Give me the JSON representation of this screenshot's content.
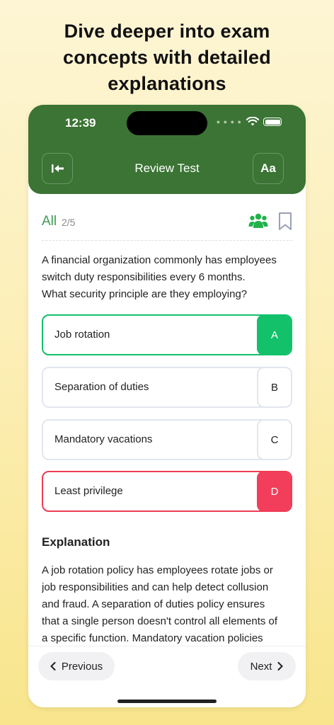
{
  "headline": {
    "line1": "Dive deeper into exam",
    "line2": "concepts with detailed",
    "line3": "explanations"
  },
  "status_bar": {
    "time": "12:39",
    "icons": [
      "wifi-icon",
      "battery-icon"
    ]
  },
  "header": {
    "title": "Review Test",
    "back_icon": "arrow-left-icon",
    "font_button_label": "Aa"
  },
  "filter": {
    "label": "All",
    "count": "2/5",
    "icons": [
      "users-icon",
      "bookmark-icon"
    ]
  },
  "question": {
    "line1": "A financial organization commonly has employees",
    "line2": "switch duty responsibilities every 6 months.",
    "line3": "What security principle are they employing?"
  },
  "options": [
    {
      "text": "Job rotation",
      "letter": "A",
      "state": "correct"
    },
    {
      "text": "Separation of duties",
      "letter": "B",
      "state": "neutral"
    },
    {
      "text": "Mandatory vacations",
      "letter": "C",
      "state": "neutral"
    },
    {
      "text": "Least privilege",
      "letter": "D",
      "state": "incorrect"
    }
  ],
  "explanation": {
    "title": "Explanation",
    "line1": "A job rotation policy has employees rotate jobs or",
    "line2": "job responsibilities and can help detect collusion",
    "line3": "and fraud. A separation of duties policy ensures",
    "line4": "that a single person doesn't control all elements of",
    "line5": "a specific function. Mandatory vacation policies"
  },
  "footer": {
    "previous_label": "Previous",
    "next_label": "Next"
  },
  "colors": {
    "header_green": "#3b7434",
    "correct": "#12c16a",
    "incorrect": "#f23e5a",
    "accent_green": "#3c9a52"
  }
}
